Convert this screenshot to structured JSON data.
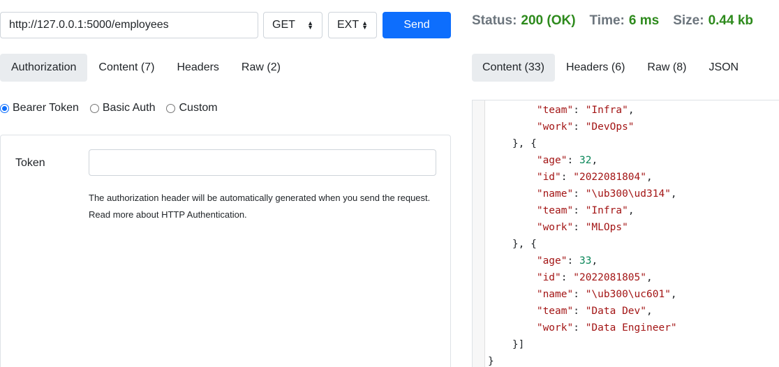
{
  "request": {
    "url": "http://127.0.0.1:5000/employees",
    "method": "GET",
    "format": "EXT",
    "send_label": "Send"
  },
  "response_status": {
    "status_label": "Status:",
    "status_value": "200 (OK)",
    "time_label": "Time:",
    "time_value": "6 ms",
    "size_label": "Size:",
    "size_value": "0.44 kb"
  },
  "request_tabs": [
    {
      "label": "Authorization",
      "active": true
    },
    {
      "label": "Content (7)",
      "active": false
    },
    {
      "label": "Headers",
      "active": false
    },
    {
      "label": "Raw (2)",
      "active": false
    }
  ],
  "response_tabs": [
    {
      "label": "Content (33)",
      "active": true
    },
    {
      "label": "Headers (6)",
      "active": false
    },
    {
      "label": "Raw (8)",
      "active": false
    },
    {
      "label": "JSON",
      "active": false
    }
  ],
  "auth": {
    "options": [
      {
        "label": "Bearer Token",
        "checked": true
      },
      {
        "label": "Basic Auth",
        "checked": false
      },
      {
        "label": "Custom",
        "checked": false
      }
    ],
    "token_label": "Token",
    "token_value": "",
    "help_line1": "The authorization header will be automatically generated when you send the request.",
    "help_line2": "Read more about HTTP Authentication."
  },
  "response_body_lines": [
    "        \"team\": \"Infra\",",
    "        \"work\": \"DevOps\"",
    "    }, {",
    "        \"age\": 32,",
    "        \"id\": \"2022081804\",",
    "        \"name\": \"\\ub300\\ud314\",",
    "        \"team\": \"Infra\",",
    "        \"work\": \"MLOps\"",
    "    }, {",
    "        \"age\": 33,",
    "        \"id\": \"2022081805\",",
    "        \"name\": \"\\ub300\\uc601\",",
    "        \"team\": \"Data Dev\",",
    "        \"work\": \"Data Engineer\"",
    "    }]",
    "}"
  ],
  "colors": {
    "accent": "#0d6efd",
    "status_ok": "#2d8a1c",
    "json_key": "#a31515",
    "json_number": "#098658"
  }
}
